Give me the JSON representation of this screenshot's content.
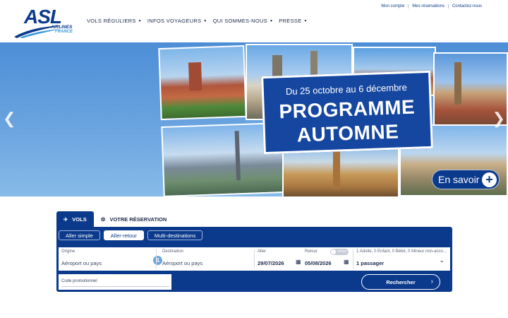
{
  "brand": {
    "logo_main": "ASL",
    "logo_airlines": "AIRLINES",
    "logo_country": "FRANCE"
  },
  "top_links": [
    "Mon compte",
    "Mes réservations",
    "Contactez-nous"
  ],
  "nav": [
    "VOLS RÉGULIERS",
    "INFOS VOYAGEURS",
    "QUI SOMMES-NOUS",
    "PRESSE"
  ],
  "hero": {
    "dates": "Du 25 octobre au 6 décembre",
    "title_line1": "PROGRAMME",
    "title_line2": "AUTOMNE",
    "cta": "En savoir",
    "cta_icon": "plus-icon",
    "prev_icon": "chevron-left-icon",
    "next_icon": "chevron-right-icon"
  },
  "booking": {
    "tabs": [
      {
        "label": "VOLS",
        "icon": "plane-icon"
      },
      {
        "label": "VOTRE RÉSERVATION",
        "icon": "gear-icon"
      }
    ],
    "trip_types": [
      "Aller simple",
      "Aller-retour",
      "Multi-destinations"
    ],
    "active_trip_type": "Aller-retour",
    "origin": {
      "label": "Origine",
      "placeholder": "Aéroport ou pays"
    },
    "destination": {
      "label": "Destination",
      "placeholder": "Aéroport ou pays"
    },
    "depart": {
      "label": "Aller",
      "value": "29/07/2026"
    },
    "return": {
      "label": "Retour",
      "value": "05/08/2026"
    },
    "toggle_label": "OPEN",
    "passengers": {
      "summary": "1 Adulte, 0 Enfant, 0 Bébé, 0 Mineur non-acco...",
      "value": "1 passager"
    },
    "promo_code_label": "Code promotionnel",
    "search_label": "Rechercher"
  },
  "colors": {
    "primary": "#0b3a8c",
    "accent": "#3a9ad9"
  }
}
